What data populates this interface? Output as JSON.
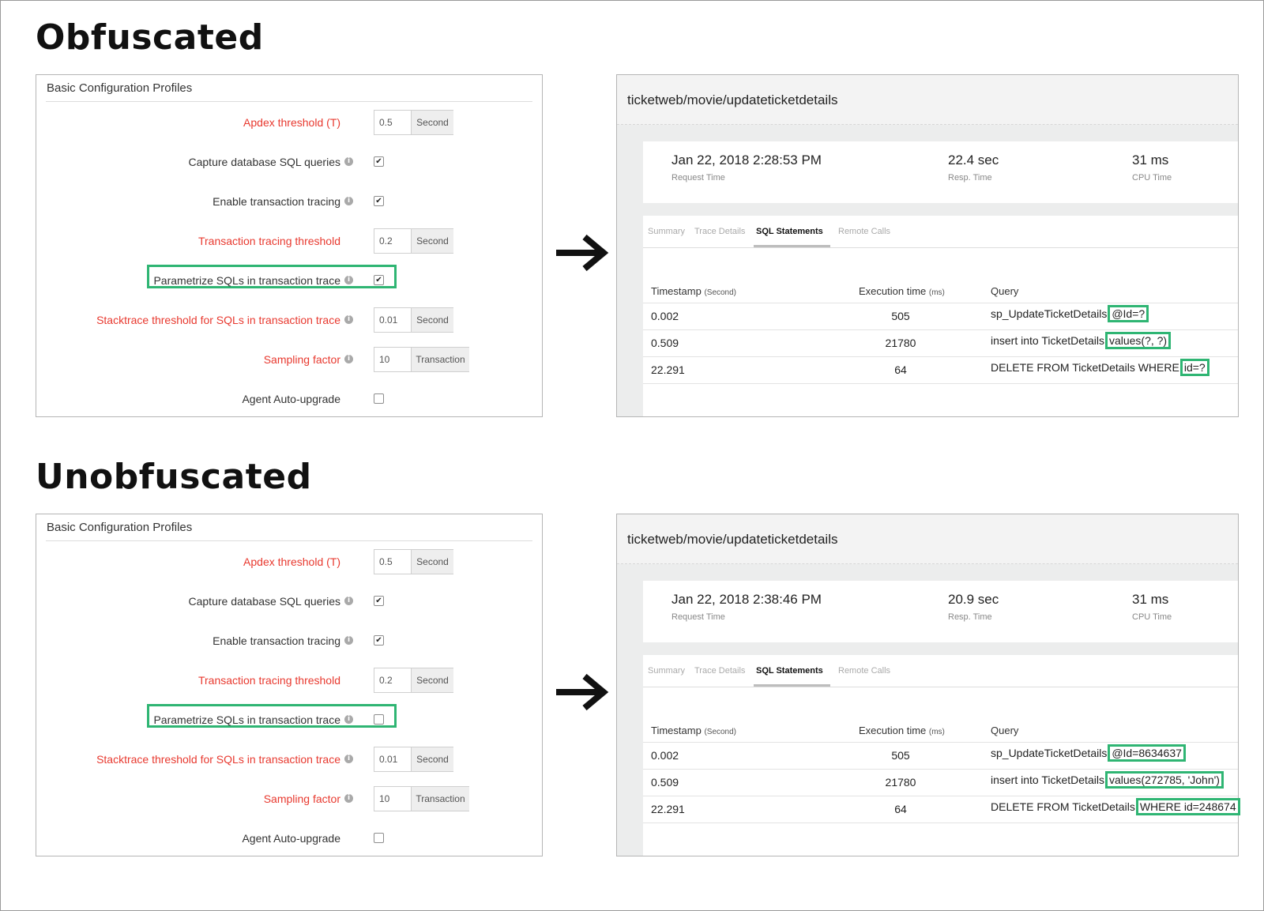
{
  "sections": [
    {
      "heading": "Obfuscated",
      "config": {
        "title": "Basic Configuration Profiles",
        "apdex": {
          "label": "Apdex threshold (T)",
          "value": "0.5",
          "unit": "Second"
        },
        "capture_sql": {
          "label": "Capture database SQL queries",
          "checked": "✔"
        },
        "enable_tracing": {
          "label": "Enable transaction tracing",
          "checked": "✔"
        },
        "tracing_threshold": {
          "label": "Transaction tracing threshold",
          "value": "0.2",
          "unit": "Second"
        },
        "parametrize": {
          "label": "Parametrize SQLs in transaction trace",
          "checked": "✔"
        },
        "stacktrace": {
          "label": "Stacktrace threshold for SQLs in transaction trace",
          "value": "0.01",
          "unit": "Second"
        },
        "sampling": {
          "label": "Sampling factor",
          "value": "10",
          "unit": "Transaction"
        },
        "auto_upgrade": {
          "label": "Agent Auto-upgrade",
          "checked": ""
        }
      },
      "trace": {
        "name": "ticketweb/movie/updateticketdetails",
        "request_time": {
          "value": "Jan 22, 2018 2:28:53 PM",
          "label": "Request Time"
        },
        "resp_time": {
          "value": "22.4 sec",
          "label": "Resp. Time"
        },
        "cpu_time": {
          "value": "31 ms",
          "label": "CPU Time"
        },
        "tabs": [
          "Summary",
          "Trace Details",
          "SQL Statements",
          "Remote Calls"
        ],
        "columns": {
          "timestamp": "Timestamp",
          "timestamp_unit": "(Second)",
          "exec": "Execution time",
          "exec_unit": "(ms)",
          "query": "Query"
        },
        "rows": [
          {
            "ts": "0.002",
            "exec": "505",
            "query": "sp_UpdateTicketDetails",
            "param": "@Id=?"
          },
          {
            "ts": "0.509",
            "exec": "21780",
            "query": "insert into TicketDetails",
            "param": "values(?, ?)"
          },
          {
            "ts": "22.291",
            "exec": "64",
            "query": "DELETE FROM TicketDetails WHERE",
            "param": "id=?"
          }
        ]
      }
    },
    {
      "heading": "Unobfuscated",
      "config": {
        "title": "Basic Configuration Profiles",
        "apdex": {
          "label": "Apdex threshold (T)",
          "value": "0.5",
          "unit": "Second"
        },
        "capture_sql": {
          "label": "Capture database SQL queries",
          "checked": "✔"
        },
        "enable_tracing": {
          "label": "Enable transaction tracing",
          "checked": "✔"
        },
        "tracing_threshold": {
          "label": "Transaction tracing threshold",
          "value": "0.2",
          "unit": "Second"
        },
        "parametrize": {
          "label": "Parametrize SQLs in transaction trace",
          "checked": ""
        },
        "stacktrace": {
          "label": "Stacktrace threshold for SQLs in transaction trace",
          "value": "0.01",
          "unit": "Second"
        },
        "sampling": {
          "label": "Sampling factor",
          "value": "10",
          "unit": "Transaction"
        },
        "auto_upgrade": {
          "label": "Agent Auto-upgrade",
          "checked": ""
        }
      },
      "trace": {
        "name": "ticketweb/movie/updateticketdetails",
        "request_time": {
          "value": "Jan 22, 2018 2:38:46 PM",
          "label": "Request Time"
        },
        "resp_time": {
          "value": "20.9 sec",
          "label": "Resp. Time"
        },
        "cpu_time": {
          "value": "31 ms",
          "label": "CPU Time"
        },
        "tabs": [
          "Summary",
          "Trace Details",
          "SQL Statements",
          "Remote Calls"
        ],
        "columns": {
          "timestamp": "Timestamp",
          "timestamp_unit": "(Second)",
          "exec": "Execution time",
          "exec_unit": "(ms)",
          "query": "Query"
        },
        "rows": [
          {
            "ts": "0.002",
            "exec": "505",
            "query": "sp_UpdateTicketDetails",
            "param": "@Id=8634637"
          },
          {
            "ts": "0.509",
            "exec": "21780",
            "query": "insert into TicketDetails",
            "param": "values(272785, 'John')"
          },
          {
            "ts": "22.291",
            "exec": "64",
            "query": "DELETE FROM TicketDetails",
            "param": "WHERE id=248674"
          }
        ]
      }
    }
  ],
  "colors": {
    "required_label": "#e8392f",
    "highlight": "#2fb573"
  }
}
